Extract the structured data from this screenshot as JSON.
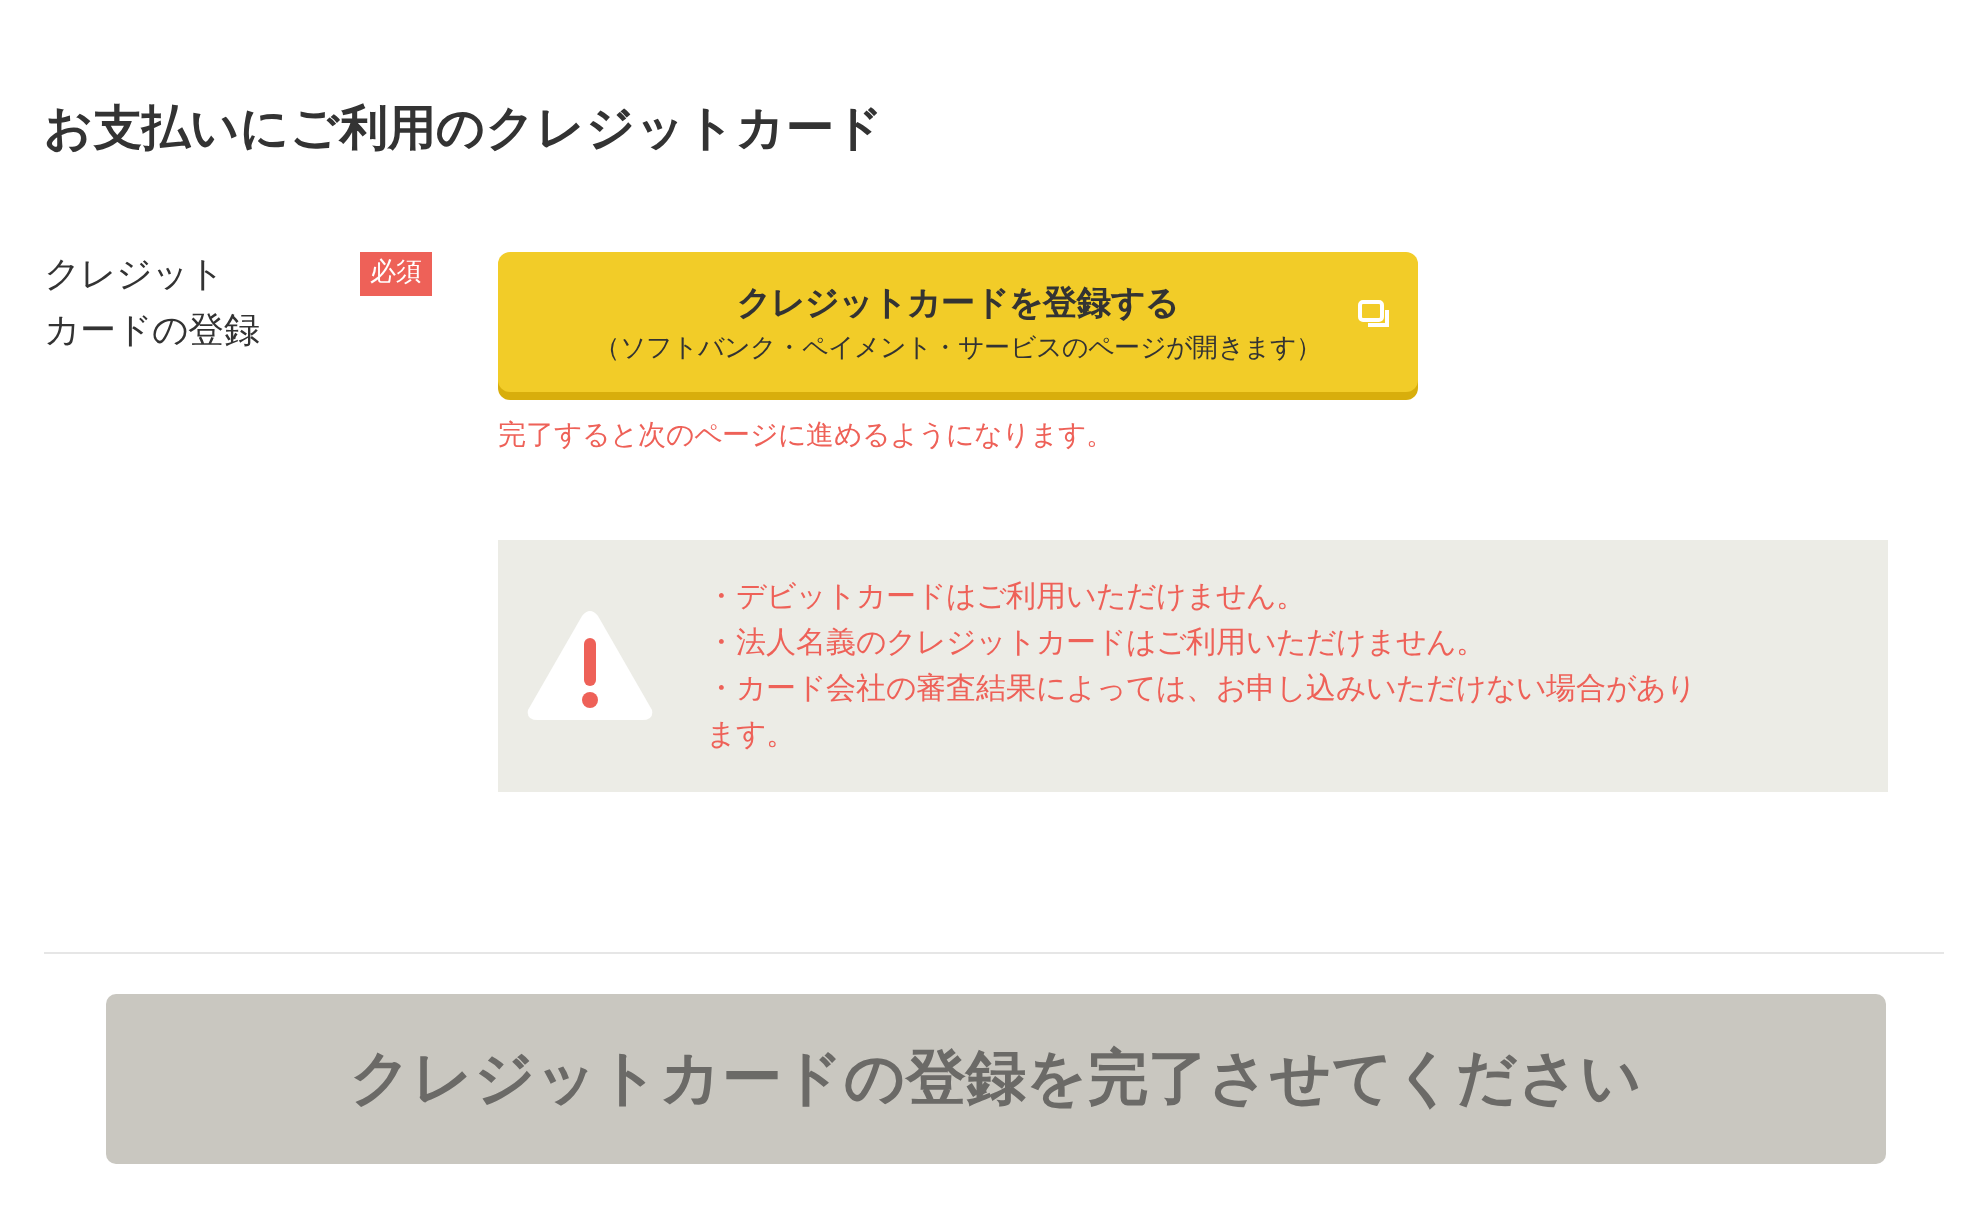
{
  "heading": "お支払いにご利用のクレジットカード",
  "field": {
    "label_lines": [
      "クレジット",
      "カードの登録"
    ],
    "required_badge": "必須"
  },
  "register_button": {
    "title": "クレジットカードを登録する",
    "subtitle": "（ソフトバンク・ペイメント・サービスのページが開きます）"
  },
  "hint": "完了すると次のページに進めるようになります。",
  "notices": [
    "・デビットカードはご利用いただけません。",
    "・法人名義のクレジットカードはご利用いただけません。",
    "・カード会社の審査結果によっては、お申し込みいただけない場合があります。"
  ],
  "submit_button": {
    "label": "クレジットカードの登録を完了させてください",
    "disabled": true
  }
}
